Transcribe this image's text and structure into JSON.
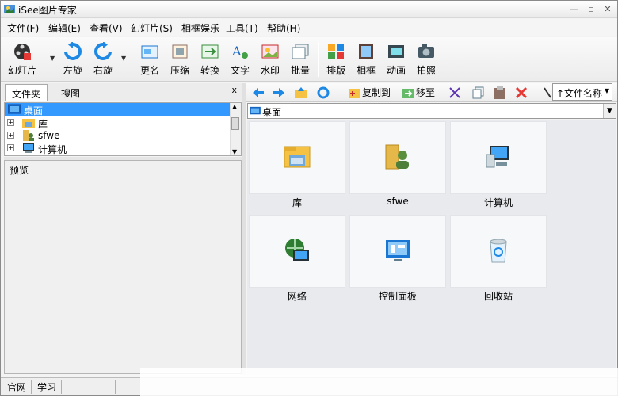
{
  "window": {
    "title": "iSee图片专家"
  },
  "menu": [
    "文件(F)",
    "编辑(E)",
    "查看(V)",
    "幻灯片(S)",
    "相框娱乐",
    "工具(T)",
    "帮助(H)"
  ],
  "toolbar": {
    "slideshow": "幻灯片",
    "rotate_left": "左旋",
    "rotate_right": "右旋",
    "rename": "更名",
    "compress": "压缩",
    "convert": "转换",
    "text": "文字",
    "watermark": "水印",
    "batch": "批量",
    "layout": "排版",
    "frame": "相框",
    "animation": "动画",
    "photo": "拍照"
  },
  "left_panel": {
    "tab_folders": "文件夹",
    "tab_thumbs": "搜图",
    "close": "x",
    "tree": [
      {
        "label": "桌面",
        "icon": "desktop-icon",
        "selected": true
      },
      {
        "label": "库",
        "icon": "library-icon",
        "selected": false
      },
      {
        "label": "sfwe",
        "icon": "user-folder-icon",
        "selected": false
      },
      {
        "label": "计算机",
        "icon": "computer-icon",
        "selected": false
      }
    ],
    "preview_label": "预览"
  },
  "nav": {
    "copy_to": "复制到",
    "move_to": "移至",
    "sort": "↑文件名称"
  },
  "address": {
    "path": "桌面"
  },
  "items": [
    {
      "name": "库",
      "icon": "library-icon"
    },
    {
      "name": "sfwe",
      "icon": "user-folder-icon"
    },
    {
      "name": "计算机",
      "icon": "computer-icon"
    },
    {
      "name": "网络",
      "icon": "network-icon"
    },
    {
      "name": "控制面板",
      "icon": "control-panel-icon"
    },
    {
      "name": "回收站",
      "icon": "recycle-bin-icon"
    }
  ],
  "status": {
    "website": "官网",
    "learn": "学习"
  },
  "colors": {
    "selection": "#3399ff",
    "content_bg": "#e8eaed"
  }
}
